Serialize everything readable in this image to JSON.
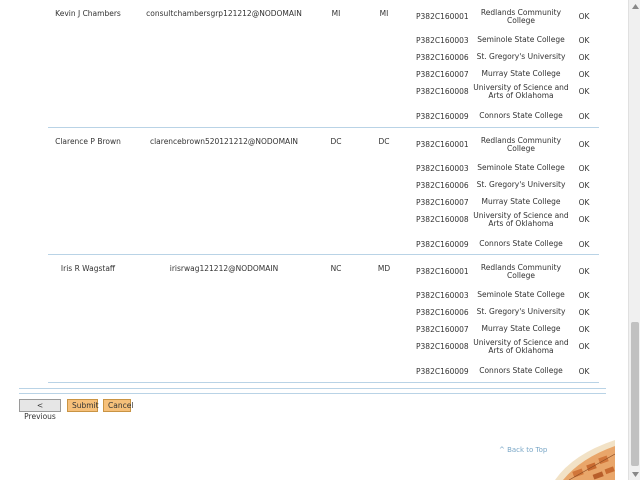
{
  "users": [
    {
      "name": "Kevin J Chambers",
      "email": "consultchambersgrp121212@NODOMAIN",
      "state1": "MI",
      "state2": "MI",
      "colleges": [
        {
          "code": "P382C160001",
          "name": "Redlands Community College",
          "status": "OK"
        },
        {
          "code": "P382C160003",
          "name": "Seminole State College",
          "status": "OK"
        },
        {
          "code": "P382C160006",
          "name": "St. Gregory's University",
          "status": "OK"
        },
        {
          "code": "P382C160007",
          "name": "Murray State College",
          "status": "OK"
        },
        {
          "code": "P382C160008",
          "name": "University of Science and Arts of Oklahoma",
          "status": "OK"
        },
        {
          "code": "P382C160009",
          "name": "Connors State College",
          "status": "OK"
        }
      ]
    },
    {
      "name": "Clarence P Brown",
      "email": "clarencebrown520121212@NODOMAIN",
      "state1": "DC",
      "state2": "DC",
      "colleges": [
        {
          "code": "P382C160001",
          "name": "Redlands Community College",
          "status": "OK"
        },
        {
          "code": "P382C160003",
          "name": "Seminole State College",
          "status": "OK"
        },
        {
          "code": "P382C160006",
          "name": "St. Gregory's University",
          "status": "OK"
        },
        {
          "code": "P382C160007",
          "name": "Murray State College",
          "status": "OK"
        },
        {
          "code": "P382C160008",
          "name": "University of Science and Arts of Oklahoma",
          "status": "OK"
        },
        {
          "code": "P382C160009",
          "name": "Connors State College",
          "status": "OK"
        }
      ]
    },
    {
      "name": "Iris R Wagstaff",
      "email": "irisrwag121212@NODOMAIN",
      "state1": "NC",
      "state2": "MD",
      "colleges": [
        {
          "code": "P382C160001",
          "name": "Redlands Community College",
          "status": "OK"
        },
        {
          "code": "P382C160003",
          "name": "Seminole State College",
          "status": "OK"
        },
        {
          "code": "P382C160006",
          "name": "St. Gregory's University",
          "status": "OK"
        },
        {
          "code": "P382C160007",
          "name": "Murray State College",
          "status": "OK"
        },
        {
          "code": "P382C160008",
          "name": "University of Science and Arts of Oklahoma",
          "status": "OK"
        },
        {
          "code": "P382C160009",
          "name": "Connors State College",
          "status": "OK"
        }
      ]
    }
  ],
  "buttons": {
    "previous": "< Previous",
    "submit": "Submit",
    "cancel": "Cancel"
  },
  "back_to_top": "^ Back to Top",
  "colors": {
    "button_accent": "#f6c07a",
    "divider": "#b9d3e6",
    "link": "#7aa7c7"
  },
  "icons": {
    "scroll_up": "chevron-up-icon",
    "scroll_down": "chevron-down-icon"
  }
}
